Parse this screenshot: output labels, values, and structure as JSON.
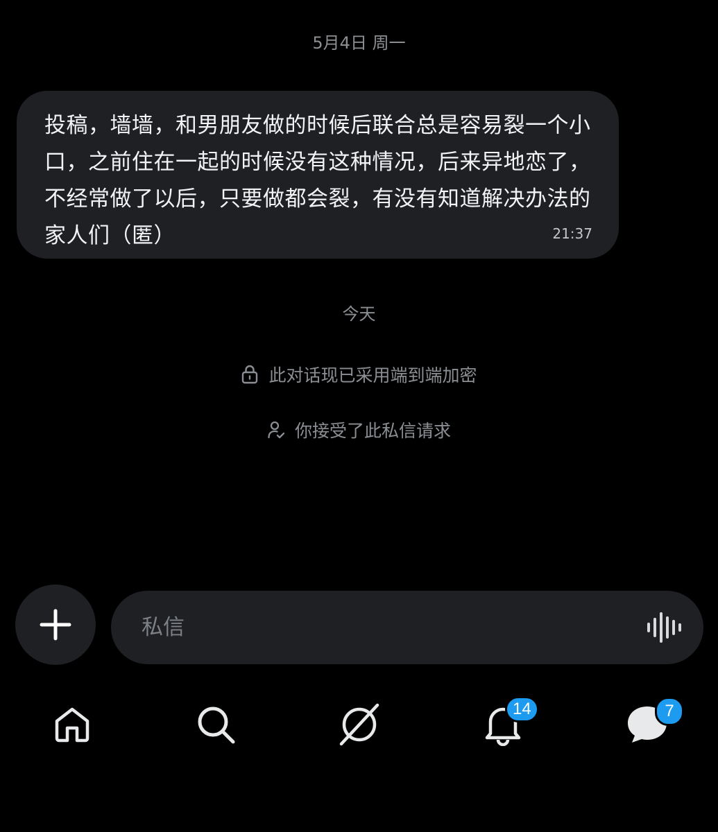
{
  "conversation": {
    "date_1": "5月4日 周一",
    "message": {
      "text": "投稿，墙墙，和男朋友做的时候后联合总是容易裂一个小口，之前住在一起的时候没有这种情况，后来异地恋了，不经常做了以后，只要做都会裂，有没有知道解决办法的家人们（匿）",
      "time": "21:37"
    },
    "date_2": "今天",
    "encryption_notice": "此对话现已采用端到端加密",
    "accepted_notice": "你接受了此私信请求"
  },
  "composer": {
    "placeholder": "私信"
  },
  "tabbar": {
    "items": [
      {
        "name": "home",
        "icon": "home-icon"
      },
      {
        "name": "search",
        "icon": "search-icon"
      },
      {
        "name": "grok",
        "icon": "grok-icon"
      },
      {
        "name": "notifications",
        "icon": "bell-icon",
        "badge": "14"
      },
      {
        "name": "messages",
        "icon": "messages-icon",
        "badge": "7"
      }
    ]
  },
  "colors": {
    "background": "#000000",
    "bubble": "#1f2023",
    "badge": "#1d9bf0",
    "muted_text": "#8b8f94"
  }
}
